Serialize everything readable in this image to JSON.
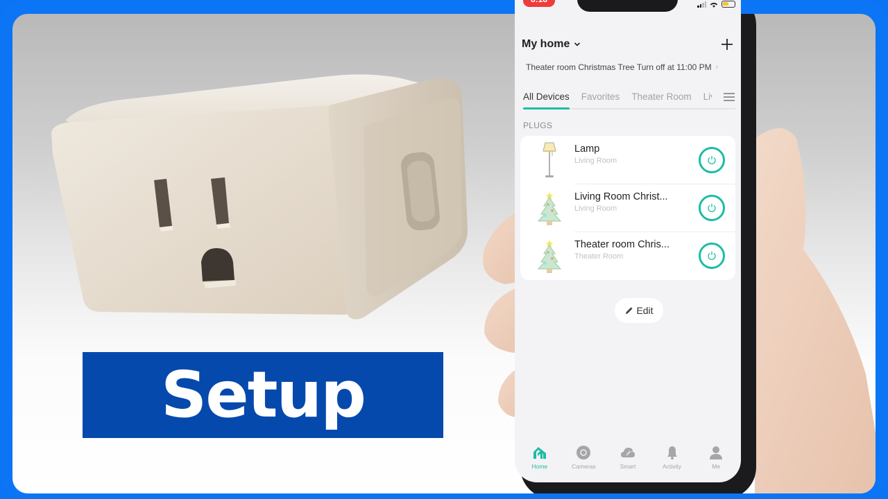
{
  "thumbnail": {
    "banner_text": "Setup",
    "frame_color": "#0b75f6",
    "banner_color": "#0549ad"
  },
  "phone": {
    "status_bar": {
      "time": "8:18"
    },
    "header": {
      "home_name": "My home",
      "home_dropdown_icon": "chevron-down-icon",
      "add_icon": "plus-icon"
    },
    "schedule_banner": {
      "text": "Theater room Christmas Tree Turn off at 11:00 PM",
      "chevron": "›"
    },
    "room_tabs": [
      {
        "label": "All Devices",
        "active": true
      },
      {
        "label": "Favorites",
        "active": false
      },
      {
        "label": "Theater Room",
        "active": false
      },
      {
        "label": "Living Room",
        "active": false
      }
    ],
    "section_label": "PLUGS",
    "devices": [
      {
        "name": "Lamp",
        "room": "Living Room",
        "icon": "floor-lamp-icon",
        "power": "on"
      },
      {
        "name": "Living Room Christ...",
        "room": "Living Room",
        "icon": "christmas-tree-icon",
        "power": "on"
      },
      {
        "name": "Theater room Chris...",
        "room": "Theater Room",
        "icon": "christmas-tree-icon",
        "power": "on"
      }
    ],
    "edit_button": "Edit",
    "bottom_nav": [
      {
        "label": "Home",
        "icon": "home-icon",
        "active": true
      },
      {
        "label": "Cameras",
        "icon": "camera-icon",
        "active": false
      },
      {
        "label": "Smart",
        "icon": "smart-cloud-icon",
        "active": false
      },
      {
        "label": "Activity",
        "icon": "bell-icon",
        "active": false
      },
      {
        "label": "Me",
        "icon": "person-icon",
        "active": false
      }
    ],
    "accent_color": "#1cbca6"
  }
}
